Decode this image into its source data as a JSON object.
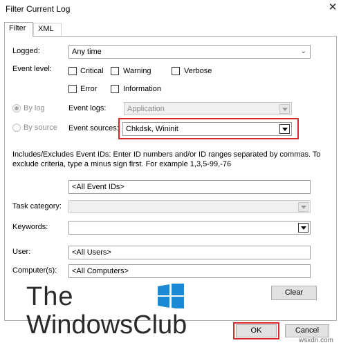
{
  "window": {
    "title": "Filter Current Log",
    "close_glyph": "✕"
  },
  "tabs": [
    {
      "label": "Filter"
    },
    {
      "label": "XML"
    }
  ],
  "logged": {
    "label": "Logged:",
    "value": "Any time"
  },
  "event_level": {
    "label": "Event level:",
    "critical": "Critical",
    "warning": "Warning",
    "verbose": "Verbose",
    "error": "Error",
    "information": "Information"
  },
  "by_log": {
    "label": "By log",
    "field_label": "Event logs:",
    "value": "Application"
  },
  "by_source": {
    "label": "By source",
    "field_label": "Event sources:",
    "value": "Chkdsk, Wininit"
  },
  "event_ids": {
    "description": "Includes/Excludes Event IDs: Enter ID numbers and/or ID ranges separated by commas. To exclude criteria, type a minus sign first. For example 1,3,5-99,-76",
    "value": "<All Event IDs>"
  },
  "task_category": {
    "label": "Task category:",
    "value": ""
  },
  "keywords": {
    "label": "Keywords:",
    "value": ""
  },
  "user": {
    "label": "User:",
    "value": "<All Users>"
  },
  "computer": {
    "label": "Computer(s):",
    "value": "<All Computers>"
  },
  "buttons": {
    "clear": "Clear",
    "ok": "OK",
    "cancel": "Cancel"
  },
  "logo": {
    "line1": "The",
    "line2": "WindowsClub"
  },
  "watermark": "wsxdn.com",
  "colors": {
    "highlight": "#d42a2a",
    "logo_blue": "#1a8ad4"
  }
}
